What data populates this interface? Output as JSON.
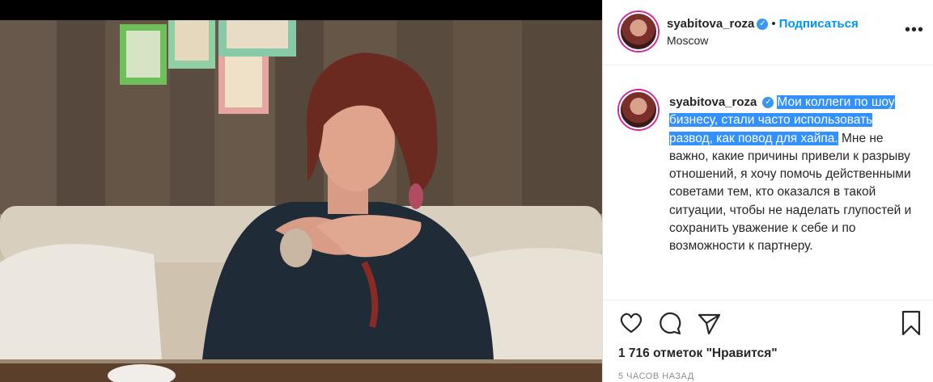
{
  "header": {
    "username": "syabitova_roza",
    "separator": "•",
    "follow_label": "Подписаться",
    "location": "Moscow",
    "more_icon": "more-icon"
  },
  "caption": {
    "username": "syabitova_roza",
    "highlighted_text": "Мои коллеги по шоу бизнесу, стали часто использовать развод, как повод для хайпа.",
    "text": " Мне не важно, какие причины привели к разрыву отношений, я хочу помочь действенными советами тем, кто оказался в такой ситуации, чтобы не наделать глупостей и сохранить уважение к себе и по возможности к партнеру."
  },
  "actions": {
    "icons": [
      "heart-icon",
      "comment-icon",
      "share-icon",
      "bookmark-icon"
    ]
  },
  "likes": "1 716 отметок \"Нравится\"",
  "time": "5 часов назад",
  "colors": {
    "accent": "#0095f6",
    "highlight": "#3390ff",
    "verified": "#3897f0"
  }
}
